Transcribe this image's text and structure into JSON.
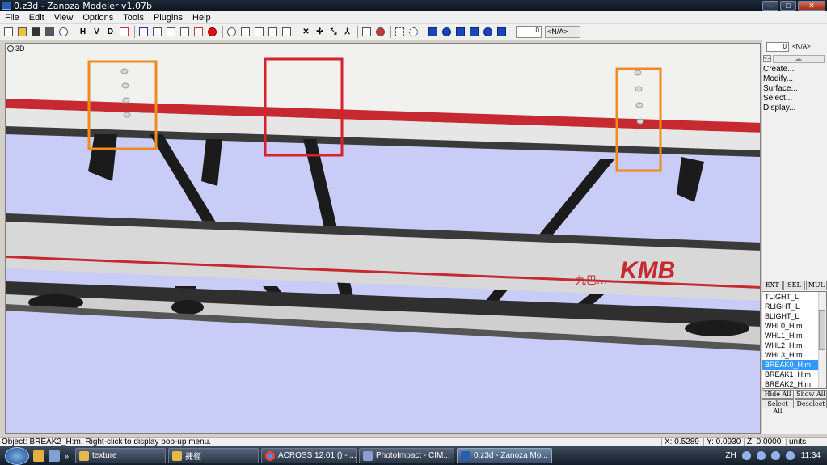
{
  "window": {
    "title": "0.z3d - Zanoza Modeler v1.07b"
  },
  "menu": [
    "File",
    "Edit",
    "View",
    "Options",
    "Tools",
    "Plugins",
    "Help"
  ],
  "toolbar": {
    "letters": [
      "H",
      "V",
      "D"
    ],
    "spinner_value": "0",
    "combo_value": "<N/A>"
  },
  "viewport": {
    "label": "3D",
    "colors": {
      "sky": "#c9ccf6",
      "rail_red": "#c62a30",
      "highlight_orange": "#f08c1e",
      "highlight_red": "#d6222c"
    },
    "logo_text": "KMB",
    "logo_sub": "九巴…"
  },
  "right_panel": {
    "spinner_value": "0",
    "combo_value": "<N/A>",
    "commands": [
      "Create...",
      "Modify...",
      "Surface...",
      "Select...",
      "Display..."
    ],
    "tabs": [
      "EXT",
      "SEL",
      "MUL"
    ],
    "objects": [
      "TLIGHT_L",
      "RLIGHT_L",
      "BLIGHT_L",
      "WHL0_H:m",
      "WHL1_H:m",
      "WHL2_H:m",
      "WHL3_H:m",
      "BREAK0_H:m",
      "BREAK1_H:m",
      "BREAK2_H:m"
    ],
    "selected_index": 7,
    "buttons_row1": [
      "Hide All",
      "Show All"
    ],
    "buttons_row2": [
      "Select All",
      "Deselect"
    ]
  },
  "status": {
    "message": "Object: BREAK2_H:m. Right-click to display pop-up menu.",
    "x": "X: 0.5289",
    "y": "Y: 0.0930",
    "z": "Z: 0.0000",
    "units": "units"
  },
  "taskbar": {
    "tasks": [
      {
        "label": "texture",
        "icon": "folder-icon"
      },
      {
        "label": "捷徑",
        "icon": "folder-icon"
      },
      {
        "label": "ACROSS 12.01 () - ...",
        "icon": "chrome-icon"
      },
      {
        "label": "PhotoImpact - CIM...",
        "icon": "photoimpact-icon"
      },
      {
        "label": "0.z3d - Zanoza Mo...",
        "icon": "zanoza-icon"
      }
    ],
    "language": "ZH",
    "clock": "11:34"
  }
}
